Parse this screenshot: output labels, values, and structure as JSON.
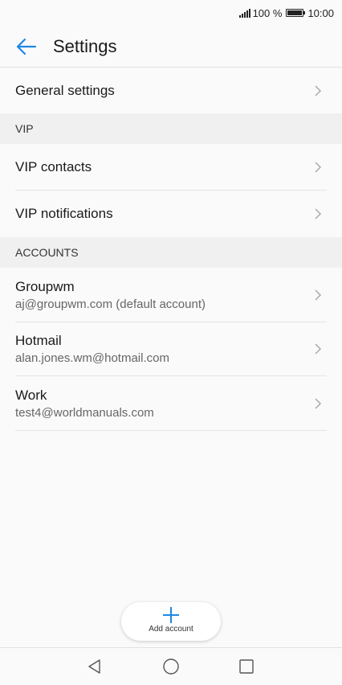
{
  "status": {
    "battery_percent": "100 %",
    "time": "10:00"
  },
  "header": {
    "title": "Settings"
  },
  "general": {
    "label": "General settings"
  },
  "vip": {
    "section_title": "VIP",
    "contacts_label": "VIP contacts",
    "notifications_label": "VIP notifications"
  },
  "accounts": {
    "section_title": "ACCOUNTS",
    "items": [
      {
        "name": "Groupwm",
        "email": "aj@groupwm.com (default account)"
      },
      {
        "name": "Hotmail",
        "email": "alan.jones.wm@hotmail.com"
      },
      {
        "name": "Work",
        "email": "test4@worldmanuals.com"
      }
    ]
  },
  "add_account": {
    "label": "Add account"
  },
  "colors": {
    "accent": "#1e88e5",
    "background": "#fafafa",
    "section_bg": "#f0f0f0"
  },
  "icons": {
    "back": "back-arrow-icon",
    "chevron": "chevron-right-icon",
    "plus": "plus-icon",
    "nav_back": "nav-back-triangle-icon",
    "nav_home": "nav-home-circle-icon",
    "nav_recent": "nav-recent-square-icon"
  }
}
